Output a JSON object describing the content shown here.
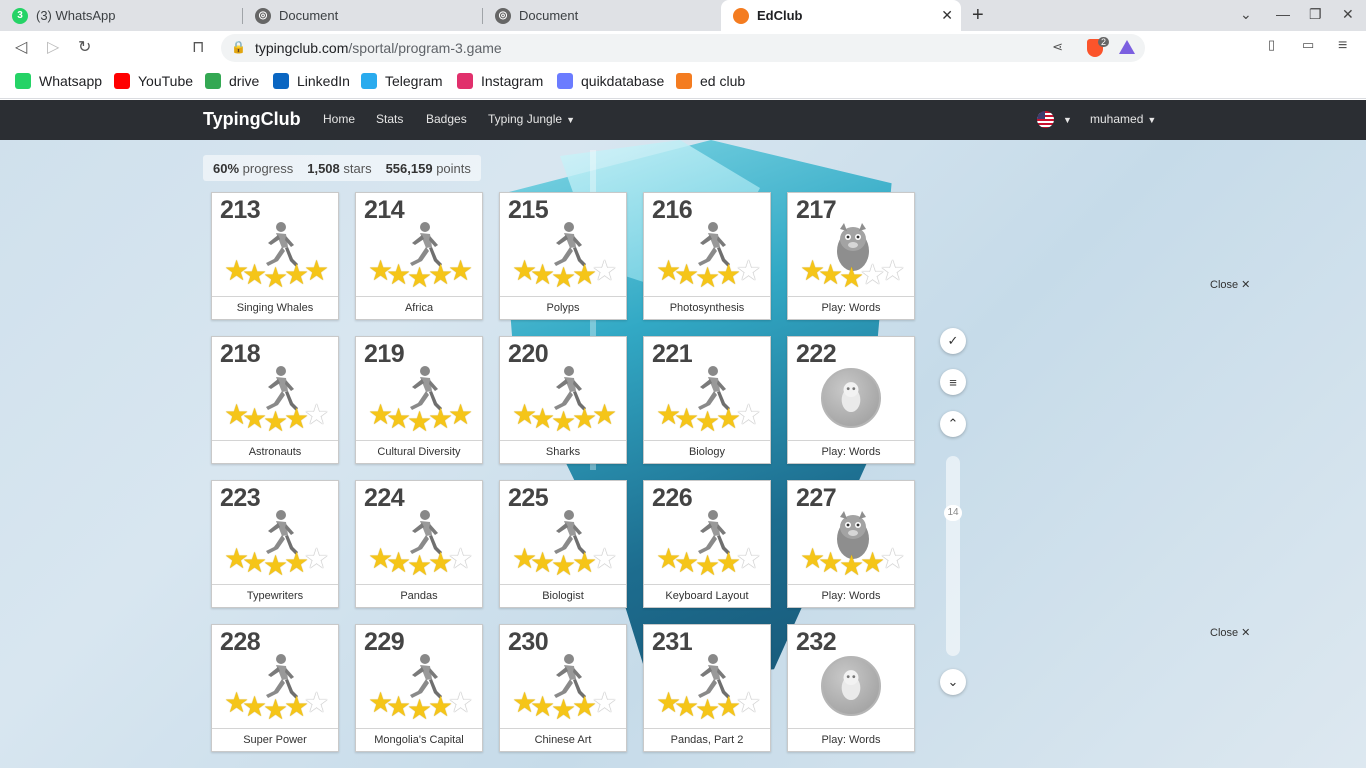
{
  "browser": {
    "tabs": [
      {
        "title": "(3) WhatsApp",
        "badge": "3"
      },
      {
        "title": "Document"
      },
      {
        "title": "Document"
      },
      {
        "title": "EdClub"
      }
    ],
    "url_domain": "typingclub.com",
    "url_path": "/sportal/program-3.game",
    "brave_count": "2",
    "bookmarks": [
      {
        "label": "Whatsapp",
        "icon": "whatsapp-icon",
        "color": "#25d366"
      },
      {
        "label": "YouTube",
        "icon": "youtube-icon",
        "color": "#ff0000"
      },
      {
        "label": "drive",
        "icon": "drive-icon",
        "color": "#34a853"
      },
      {
        "label": "LinkedIn",
        "icon": "linkedin-icon",
        "color": "#0a66c2"
      },
      {
        "label": "Telegram",
        "icon": "telegram-icon",
        "color": "#2aabee"
      },
      {
        "label": "Instagram",
        "icon": "instagram-icon",
        "color": "#e1306c"
      },
      {
        "label": "quikdatabase",
        "icon": "bolt-icon",
        "color": "#6b7cff"
      },
      {
        "label": "ed club",
        "icon": "edclub-icon",
        "color": "#f47c20"
      }
    ]
  },
  "site": {
    "brand": "TypingClub",
    "nav": [
      "Home",
      "Stats",
      "Badges",
      "Typing Jungle"
    ],
    "user": "muhamed",
    "stats": {
      "progress": "60%",
      "progress_label": "progress",
      "stars": "1,508",
      "stars_label": "stars",
      "points": "556,159",
      "points_label": "points"
    },
    "lessons": [
      {
        "num": "213",
        "label": "Singing Whales",
        "type": "runner",
        "stars": 5
      },
      {
        "num": "214",
        "label": "Africa",
        "type": "runner",
        "stars": 5
      },
      {
        "num": "215",
        "label": "Polyps",
        "type": "runner",
        "stars": 4
      },
      {
        "num": "216",
        "label": "Photosynthesis",
        "type": "runner",
        "stars": 4
      },
      {
        "num": "217",
        "label": "Play: Words",
        "type": "game",
        "stars": 3
      },
      {
        "num": "218",
        "label": "Astronauts",
        "type": "runner",
        "stars": 4
      },
      {
        "num": "219",
        "label": "Cultural Diversity",
        "type": "runner",
        "stars": 5
      },
      {
        "num": "220",
        "label": "Sharks",
        "type": "runner",
        "stars": 5
      },
      {
        "num": "221",
        "label": "Biology",
        "type": "runner",
        "stars": 4
      },
      {
        "num": "222",
        "label": "Play: Words",
        "type": "locked",
        "stars": 0
      },
      {
        "num": "223",
        "label": "Typewriters",
        "type": "runner",
        "stars": 4
      },
      {
        "num": "224",
        "label": "Pandas",
        "type": "runner",
        "stars": 4
      },
      {
        "num": "225",
        "label": "Biologist",
        "type": "runner",
        "stars": 4
      },
      {
        "num": "226",
        "label": "Keyboard Layout",
        "type": "runner",
        "stars": 4
      },
      {
        "num": "227",
        "label": "Play: Words",
        "type": "game",
        "stars": 4
      },
      {
        "num": "228",
        "label": "Super Power",
        "type": "runner",
        "stars": 4
      },
      {
        "num": "229",
        "label": "Mongolia's Capital",
        "type": "runner",
        "stars": 4
      },
      {
        "num": "230",
        "label": "Chinese Art",
        "type": "runner",
        "stars": 4
      },
      {
        "num": "231",
        "label": "Pandas, Part 2",
        "type": "runner",
        "stars": 4
      },
      {
        "num": "232",
        "label": "Play: Words",
        "type": "locked",
        "stars": 0
      }
    ],
    "scroll_position": "14",
    "close_label": "Close"
  }
}
